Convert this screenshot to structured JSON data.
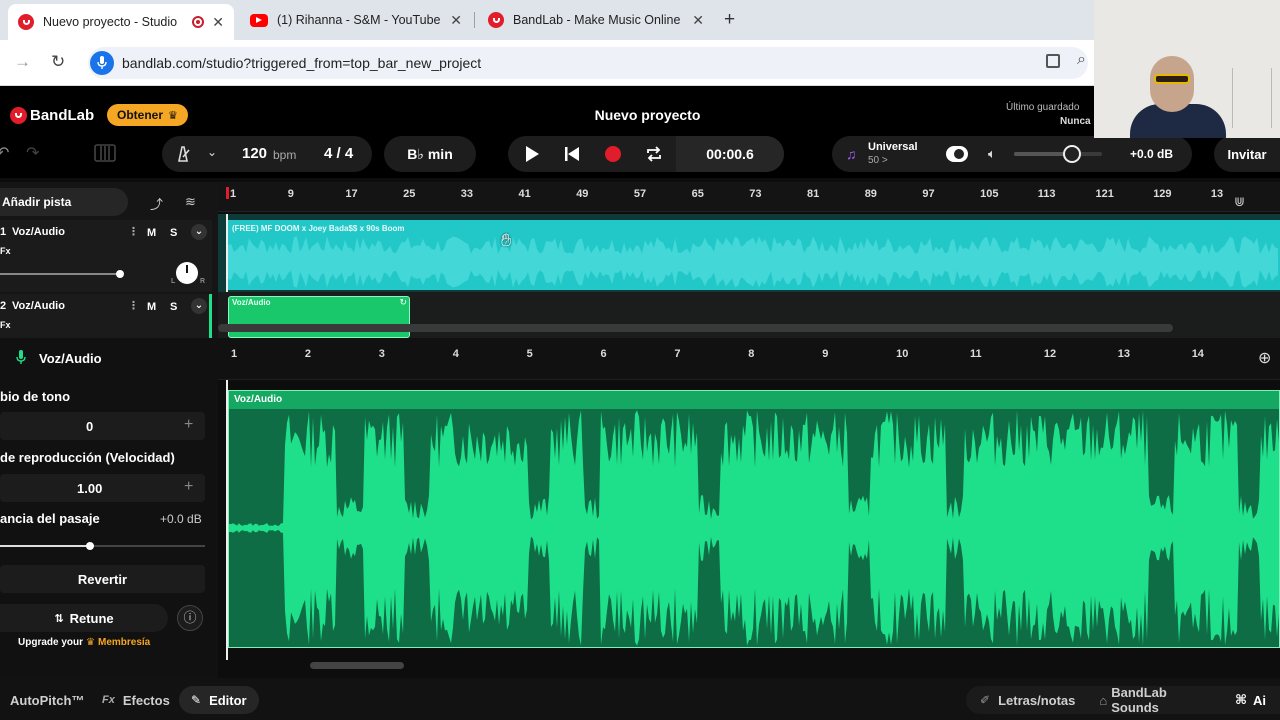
{
  "browser": {
    "tabs": [
      {
        "title": "Nuevo proyecto - Studio",
        "favicon": "bandlab-icon",
        "active": true
      },
      {
        "title": "(1) Rihanna - S&M - YouTube",
        "favicon": "youtube-icon",
        "active": false
      },
      {
        "title": "BandLab - Make Music Online",
        "favicon": "bandlab-icon",
        "active": false
      }
    ],
    "new_tab": "+",
    "url": "bandlab.com/studio?triggered_from=top_bar_new_project"
  },
  "app": {
    "logo": "BandLab",
    "obtener": "Obtener",
    "project_title": "Nuevo proyecto",
    "saved_label": "Último guardado",
    "saved_value": "Nunca"
  },
  "toolbar": {
    "tempo": "120",
    "tempo_unit": "bpm",
    "time_sig": "4 / 4",
    "key": "B♭ min",
    "time": "00:00.6",
    "preset_name": "Universal",
    "preset_sub": "50 >",
    "volume_db": "+0.0 dB",
    "volume_level": 0.66,
    "invite": "Invitar"
  },
  "tracks": {
    "add_track": "Añadir pista",
    "items": [
      {
        "number": "1",
        "name": "Voz/Audio",
        "fx": "Fx",
        "mute": "M",
        "solo": "S",
        "pan_left": "L",
        "pan_right": "R"
      },
      {
        "number": "2",
        "name": "Voz/Audio",
        "fx": "Fx",
        "mute": "M",
        "solo": "S"
      }
    ],
    "ruler": [
      "1",
      "9",
      "17",
      "25",
      "33",
      "41",
      "49",
      "57",
      "65",
      "73",
      "81",
      "89",
      "97",
      "105",
      "113",
      "121",
      "129",
      "13"
    ],
    "clip1_title": "(FREE) MF DOOM x Joey Bada$$ x 90s Boom",
    "clip2_title": "Voz/Audio"
  },
  "editor": {
    "track_name": "Voz/Audio",
    "ruler": [
      "1",
      "2",
      "3",
      "4",
      "5",
      "6",
      "7",
      "8",
      "9",
      "10",
      "11",
      "12",
      "13",
      "14"
    ],
    "clip_title": "Voz/Audio",
    "pitch_label": "bio de tono",
    "pitch_value": "0",
    "speed_label": "de reproducción (Velocidad)",
    "speed_value": "1.00",
    "gain_label": "ancia del pasaje",
    "gain_value": "+0.0 dB",
    "gain_level": 0.44,
    "revert": "Revertir",
    "retune": "Retune",
    "upgrade_text": "Upgrade your",
    "membership": "Membresía"
  },
  "bottom": {
    "autopitch": "AutoPitch™",
    "fx_prefix": "Fx",
    "efectos": "Efectos",
    "editor": "Editor",
    "lyrics": "Letras/notas",
    "sounds": "BandLab Sounds",
    "ai": "Ai"
  },
  "colors": {
    "brand_red": "#e11d2b",
    "waveform_cyan": "#22c8c8",
    "waveform_green": "#1fe08a",
    "accent_orange": "#f5a623"
  }
}
